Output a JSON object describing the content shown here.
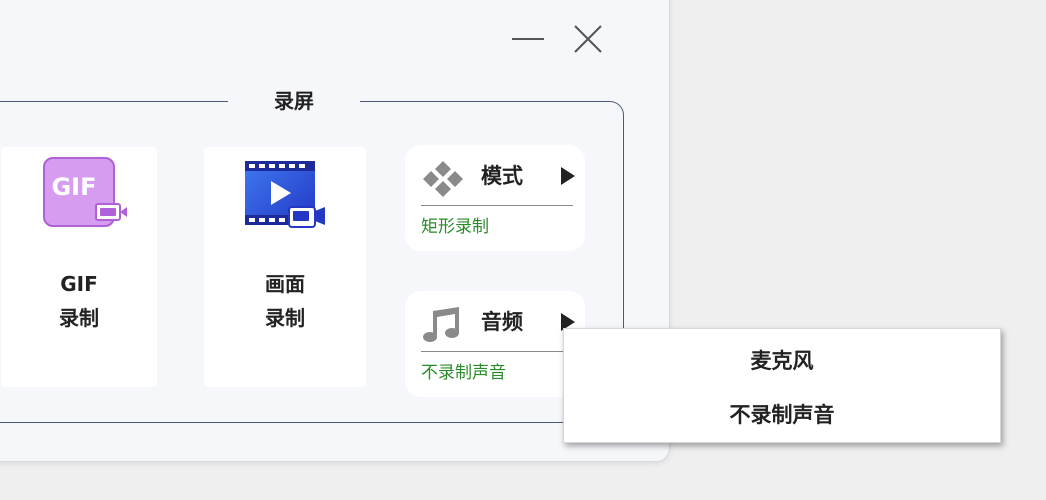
{
  "window": {
    "minimize_icon": "minimize-icon",
    "close_icon": "close-icon"
  },
  "section": {
    "title": "录屏"
  },
  "tiles": [
    {
      "id": "gif",
      "line1": "GIF",
      "line2": "录制",
      "icon": "gif-record-icon",
      "icon_text": "GIF",
      "color": "#d59cf0"
    },
    {
      "id": "screen",
      "line1": "画面",
      "line2": "录制",
      "icon": "video-record-icon",
      "color": "#2f55d8"
    }
  ],
  "options": {
    "mode": {
      "label": "模式",
      "value": "矩形录制",
      "icon": "diamond-grid-icon"
    },
    "audio": {
      "label": "音频",
      "value": "不录制声音",
      "icon": "music-note-icon"
    }
  },
  "audio_menu": {
    "items": [
      "麦克风",
      "不录制声音"
    ]
  },
  "colors": {
    "accent_green": "#2a8b2a",
    "border": "#4a5a78"
  }
}
